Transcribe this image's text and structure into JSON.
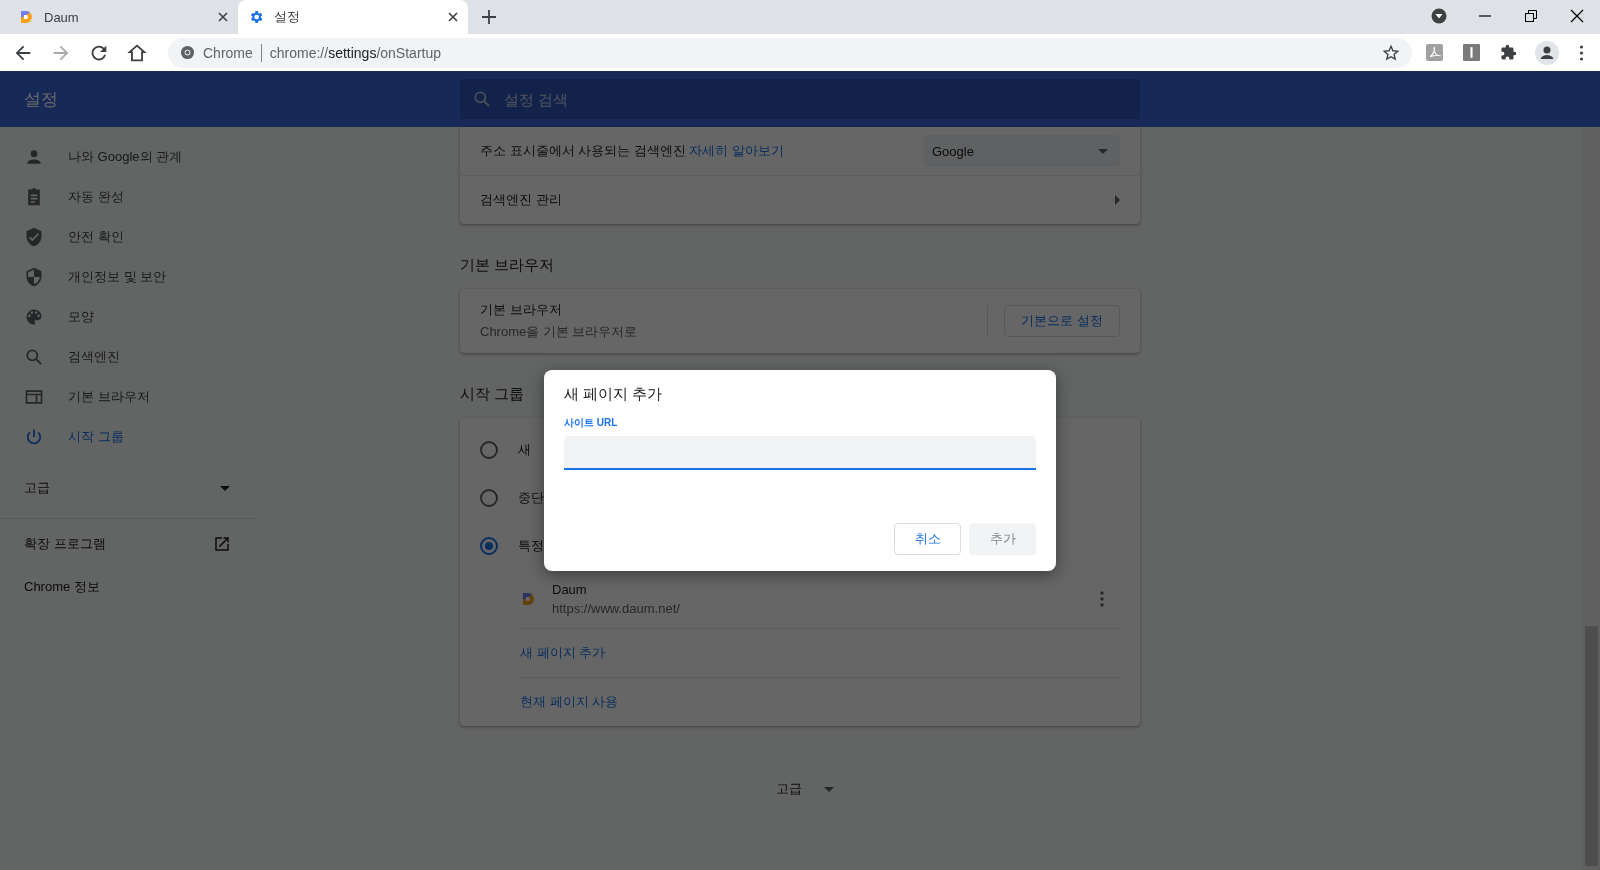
{
  "tabs": [
    {
      "title": "Daum",
      "kind": "site",
      "selected": false
    },
    {
      "title": "설정",
      "kind": "settings",
      "selected": true
    }
  ],
  "toolbar": {
    "origin": "Chrome",
    "url_host": "chrome://",
    "url_path": "settings",
    "url_rest": "/onStartup"
  },
  "header": {
    "title": "설정",
    "search_placeholder": "설정 검색"
  },
  "sidebar": {
    "items": [
      {
        "label": "나와 Google의 관계",
        "selected": false
      },
      {
        "label": "자동 완성",
        "selected": false
      },
      {
        "label": "안전 확인",
        "selected": false
      },
      {
        "label": "개인정보 및 보안",
        "selected": false
      },
      {
        "label": "모양",
        "selected": false
      },
      {
        "label": "검색엔진",
        "selected": false
      },
      {
        "label": "기본 브라우저",
        "selected": false
      },
      {
        "label": "시작 그룹",
        "selected": true
      }
    ],
    "advanced": "고급",
    "extensions": "확장 프로그램",
    "about": "Chrome 정보"
  },
  "search_engine": {
    "label": "주소 표시줄에서 사용되는 검색엔진",
    "link": "자세히 알아보기",
    "value": "Google",
    "manage": "검색엔진 관리"
  },
  "default_browser": {
    "section": "기본 브라우저",
    "title": "기본 브라우저",
    "subtitle": "Chrome을 기본 브라우저로",
    "button": "기본으로 설정"
  },
  "startup": {
    "section": "시작 그룹",
    "options": [
      {
        "label": "새",
        "selected": false
      },
      {
        "label": "중단",
        "selected": false
      },
      {
        "label": "특정",
        "selected": true
      }
    ],
    "pages": [
      {
        "name": "Daum",
        "url": "https://www.daum.net/"
      }
    ],
    "add_link": "새 페이지 추가",
    "use_current_link": "현재 페이지 사용"
  },
  "bottom_advanced": "고급",
  "dialog": {
    "title": "새 페이지 추가",
    "field_label": "사이트 URL",
    "buttons": [
      {
        "label": "취소",
        "disabled": false
      },
      {
        "label": "추가",
        "disabled": true
      }
    ]
  }
}
